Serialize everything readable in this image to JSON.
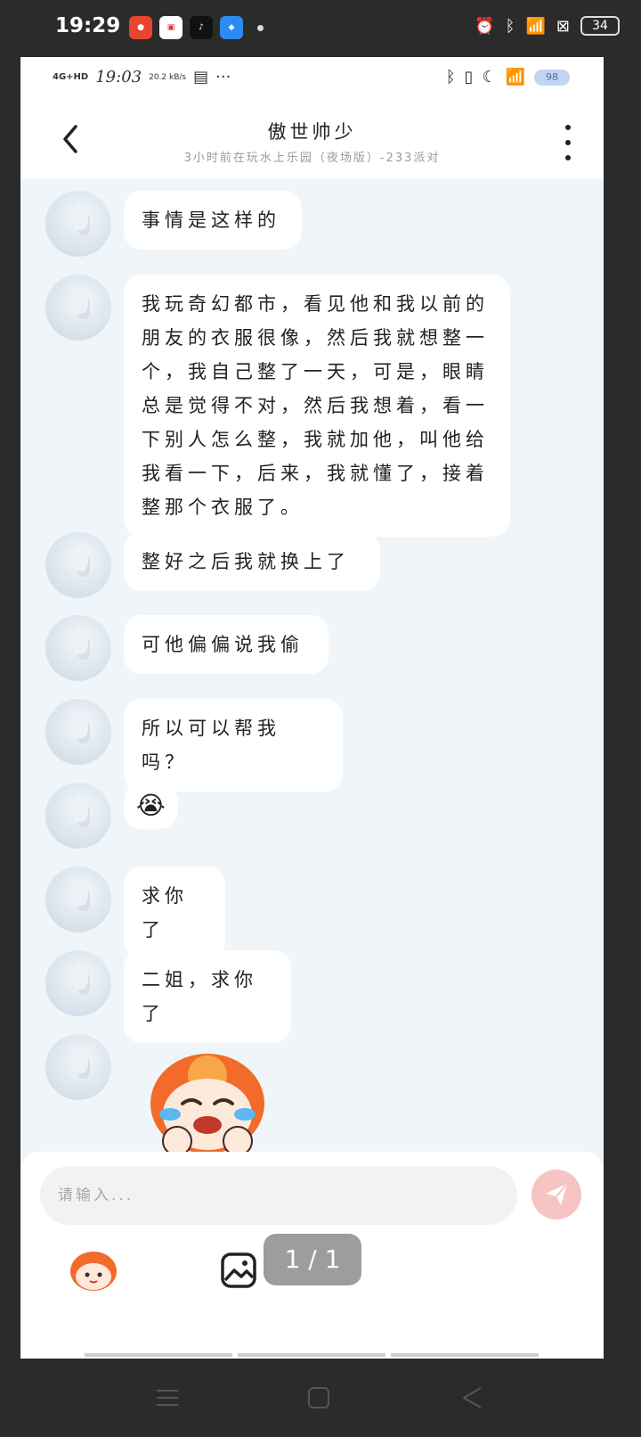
{
  "outer_status": {
    "time": "19:29",
    "battery": "34",
    "app_icons": [
      "app-icon-red",
      "video-app-icon",
      "tiktok-icon",
      "blue-app-icon"
    ]
  },
  "inner_status": {
    "network": "4G+HD",
    "time": "19:03",
    "speed": "20.2 kB/s",
    "battery": "98"
  },
  "header": {
    "title": "傲世帅少",
    "subtitle": "3小时前在玩水上乐园（夜场版）-233派对"
  },
  "messages": [
    {
      "type": "text",
      "text": "事情是这样的"
    },
    {
      "type": "text",
      "text": "我玩奇幻都市，看见他和我以前的朋友的衣服很像，然后我就想整一个，我自己整了一天，可是，眼睛总是觉得不对，然后我想着，看一下别人怎么整，我就加他，叫他给我看一下，后来，我就懂了，接着整那个衣服了。"
    },
    {
      "type": "text",
      "text": "整好之后我就换上了"
    },
    {
      "type": "text",
      "text": "可他偏偏说我偷"
    },
    {
      "type": "text",
      "text": "所以可以帮我吗？"
    },
    {
      "type": "emoji",
      "text": "😭"
    },
    {
      "type": "text",
      "text": "求你了"
    },
    {
      "type": "text",
      "text": "二姐，求你了"
    },
    {
      "type": "sticker",
      "icon": "crying-mascot-sticker"
    }
  ],
  "input": {
    "placeholder": "请输入..."
  },
  "pager": "1 / 1",
  "colors": {
    "chat_bg": "#f0f5f9",
    "bubble_bg": "#ffffff",
    "send_button": "#f7c4c4",
    "outer_bg": "#2b2b2b"
  }
}
